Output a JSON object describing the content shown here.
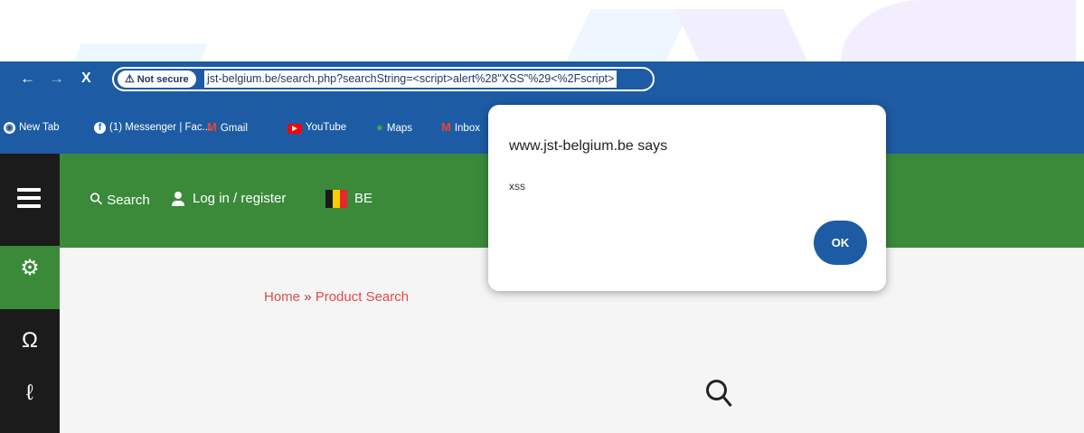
{
  "browser": {
    "security_label": "Not secure",
    "url": "jst-belgium.be/search.php?searchString=<script>alert%28\"XSS\"%29<%2Fscript>"
  },
  "bookmarks": [
    {
      "label": "New Tab",
      "icon": "globe-icon"
    },
    {
      "label": "(1) Messenger | Fac...",
      "icon": "facebook-icon"
    },
    {
      "label": "Gmail",
      "icon": "gmail-icon"
    },
    {
      "label": "YouTube",
      "icon": "youtube-icon"
    },
    {
      "label": "Maps",
      "icon": "maps-pin-icon"
    },
    {
      "label": "Inbox",
      "icon": "gmail-icon"
    }
  ],
  "header": {
    "search_label": "Search",
    "login_label": "Log in / register",
    "country_label": "BE"
  },
  "breadcrumb": {
    "home": "Home",
    "separator": "»",
    "current": "Product Search"
  },
  "dialog": {
    "title": "www.jst-belgium.be says",
    "message": "xss",
    "ok_label": "OK"
  },
  "colors": {
    "browser_chrome": "#1d5ba4",
    "site_green": "#3a8a3a",
    "sidebar_dark": "#1b1b1b",
    "breadcrumb_red": "#e34a4a",
    "flag_black": "#1a1a1a",
    "flag_yellow": "#f5d000",
    "flag_red": "#e8262c"
  }
}
